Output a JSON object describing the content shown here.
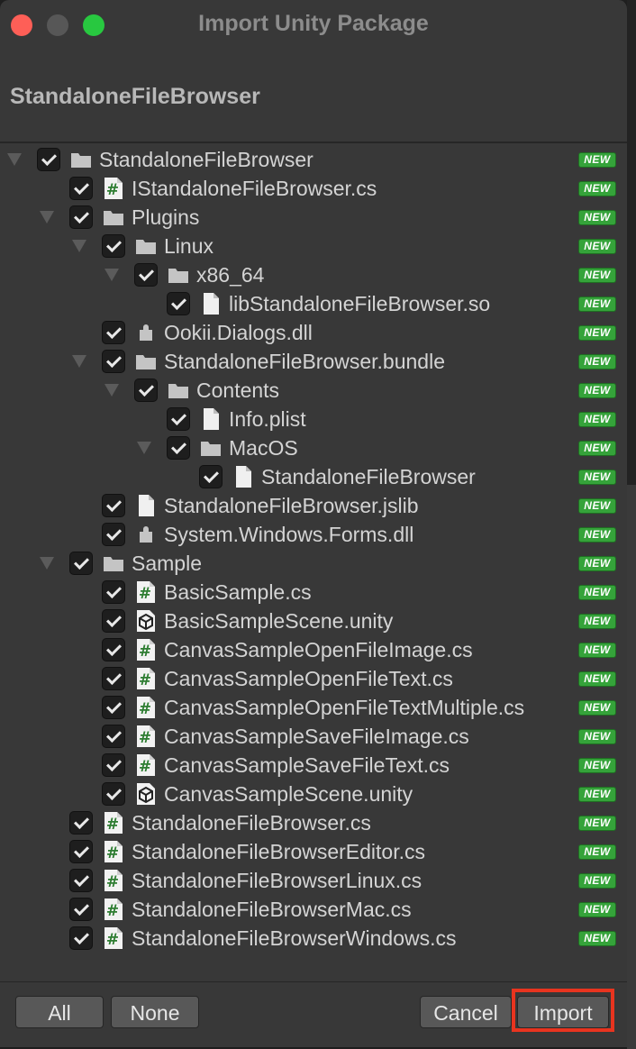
{
  "window": {
    "title": "Import Unity Package",
    "package_name": "StandaloneFileBrowser"
  },
  "badge_text": "NEW",
  "colors": {
    "badge": "#35a33a",
    "highlight": "#e8341f",
    "close": "#fe5f57",
    "maximize": "#28c840"
  },
  "tree": [
    {
      "label": "StandaloneFileBrowser",
      "icon": "folder-icon",
      "depth": 0,
      "expander": true,
      "checked": true
    },
    {
      "label": "IStandaloneFileBrowser.cs",
      "icon": "csharp-script-icon",
      "depth": 1,
      "expander": false,
      "checked": true
    },
    {
      "label": "Plugins",
      "icon": "folder-icon",
      "depth": 1,
      "expander": true,
      "checked": true
    },
    {
      "label": "Linux",
      "icon": "folder-icon",
      "depth": 2,
      "expander": true,
      "checked": true
    },
    {
      "label": "x86_64",
      "icon": "folder-icon",
      "depth": 3,
      "expander": true,
      "checked": true
    },
    {
      "label": "libStandaloneFileBrowser.so",
      "icon": "file-icon",
      "depth": 4,
      "expander": false,
      "checked": true
    },
    {
      "label": "Ookii.Dialogs.dll",
      "icon": "plugin-icon",
      "depth": 2,
      "expander": false,
      "checked": true
    },
    {
      "label": "StandaloneFileBrowser.bundle",
      "icon": "folder-icon",
      "depth": 2,
      "expander": true,
      "checked": true
    },
    {
      "label": "Contents",
      "icon": "folder-icon",
      "depth": 3,
      "expander": true,
      "checked": true
    },
    {
      "label": "Info.plist",
      "icon": "file-icon",
      "depth": 4,
      "expander": false,
      "checked": true
    },
    {
      "label": "MacOS",
      "icon": "folder-icon",
      "depth": 4,
      "expander": true,
      "checked": true
    },
    {
      "label": "StandaloneFileBrowser",
      "icon": "file-icon",
      "depth": 5,
      "expander": false,
      "checked": true
    },
    {
      "label": "StandaloneFileBrowser.jslib",
      "icon": "file-icon",
      "depth": 2,
      "expander": false,
      "checked": true
    },
    {
      "label": "System.Windows.Forms.dll",
      "icon": "plugin-icon",
      "depth": 2,
      "expander": false,
      "checked": true
    },
    {
      "label": "Sample",
      "icon": "folder-icon",
      "depth": 1,
      "expander": true,
      "checked": true
    },
    {
      "label": "BasicSample.cs",
      "icon": "csharp-script-icon",
      "depth": 2,
      "expander": false,
      "checked": true
    },
    {
      "label": "BasicSampleScene.unity",
      "icon": "unity-scene-icon",
      "depth": 2,
      "expander": false,
      "checked": true
    },
    {
      "label": "CanvasSampleOpenFileImage.cs",
      "icon": "csharp-script-icon",
      "depth": 2,
      "expander": false,
      "checked": true
    },
    {
      "label": "CanvasSampleOpenFileText.cs",
      "icon": "csharp-script-icon",
      "depth": 2,
      "expander": false,
      "checked": true
    },
    {
      "label": "CanvasSampleOpenFileTextMultiple.cs",
      "icon": "csharp-script-icon",
      "depth": 2,
      "expander": false,
      "checked": true
    },
    {
      "label": "CanvasSampleSaveFileImage.cs",
      "icon": "csharp-script-icon",
      "depth": 2,
      "expander": false,
      "checked": true
    },
    {
      "label": "CanvasSampleSaveFileText.cs",
      "icon": "csharp-script-icon",
      "depth": 2,
      "expander": false,
      "checked": true
    },
    {
      "label": "CanvasSampleScene.unity",
      "icon": "unity-scene-icon",
      "depth": 2,
      "expander": false,
      "checked": true
    },
    {
      "label": "StandaloneFileBrowser.cs",
      "icon": "csharp-script-icon",
      "depth": 1,
      "expander": false,
      "checked": true
    },
    {
      "label": "StandaloneFileBrowserEditor.cs",
      "icon": "csharp-script-icon",
      "depth": 1,
      "expander": false,
      "checked": true
    },
    {
      "label": "StandaloneFileBrowserLinux.cs",
      "icon": "csharp-script-icon",
      "depth": 1,
      "expander": false,
      "checked": true
    },
    {
      "label": "StandaloneFileBrowserMac.cs",
      "icon": "csharp-script-icon",
      "depth": 1,
      "expander": false,
      "checked": true
    },
    {
      "label": "StandaloneFileBrowserWindows.cs",
      "icon": "csharp-script-icon",
      "depth": 1,
      "expander": false,
      "checked": true
    }
  ],
  "footer": {
    "all_label": "All",
    "none_label": "None",
    "cancel_label": "Cancel",
    "import_label": "Import"
  }
}
